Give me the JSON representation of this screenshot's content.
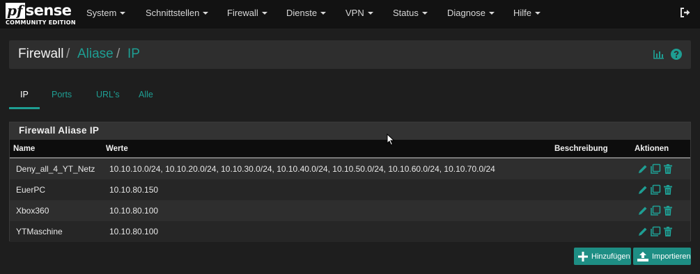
{
  "brand": {
    "logo_pf": "pf",
    "logo_sense": "sense",
    "edition": "COMMUNITY EDITION"
  },
  "nav": {
    "items": [
      {
        "label": "System"
      },
      {
        "label": "Schnittstellen"
      },
      {
        "label": "Firewall"
      },
      {
        "label": "Dienste"
      },
      {
        "label": "VPN"
      },
      {
        "label": "Status"
      },
      {
        "label": "Diagnose"
      },
      {
        "label": "Hilfe"
      }
    ],
    "logout_icon": "sign-out-icon"
  },
  "breadcrumb": {
    "root": "Firewall",
    "sep1": "/",
    "level2": "Aliase",
    "sep2": "/",
    "level3": "IP",
    "icons": [
      "chart-icon",
      "help-icon"
    ]
  },
  "tabs": [
    {
      "label": "IP",
      "active": true
    },
    {
      "label": "Ports",
      "active": false
    },
    {
      "label": "URL's",
      "active": false
    },
    {
      "label": "Alle",
      "active": false
    }
  ],
  "panel": {
    "title": "Firewall Aliase IP",
    "columns": {
      "name": "Name",
      "values": "Werte",
      "description": "Beschreibung",
      "actions": "Aktionen"
    },
    "rows": [
      {
        "name": "Deny_all_4_YT_Netz",
        "values": "10.10.10.0/24, 10.10.20.0/24, 10.10.30.0/24, 10.10.40.0/24, 10.10.50.0/24, 10.10.60.0/24, 10.10.70.0/24",
        "description": ""
      },
      {
        "name": "EuerPC",
        "values": "10.10.80.150",
        "description": ""
      },
      {
        "name": "Xbox360",
        "values": "10.10.80.100",
        "description": ""
      },
      {
        "name": "YTMaschine",
        "values": "10.10.80.100",
        "description": ""
      }
    ],
    "row_action_icons": [
      "pencil-icon",
      "copy-icon",
      "trash-icon"
    ]
  },
  "buttons": {
    "add": "Hinzufügen",
    "import": "Importieren"
  },
  "colors": {
    "accent": "#1e9e93",
    "button": "#1e8e84",
    "navbar": "#121212",
    "background": "#1e1e1e"
  }
}
